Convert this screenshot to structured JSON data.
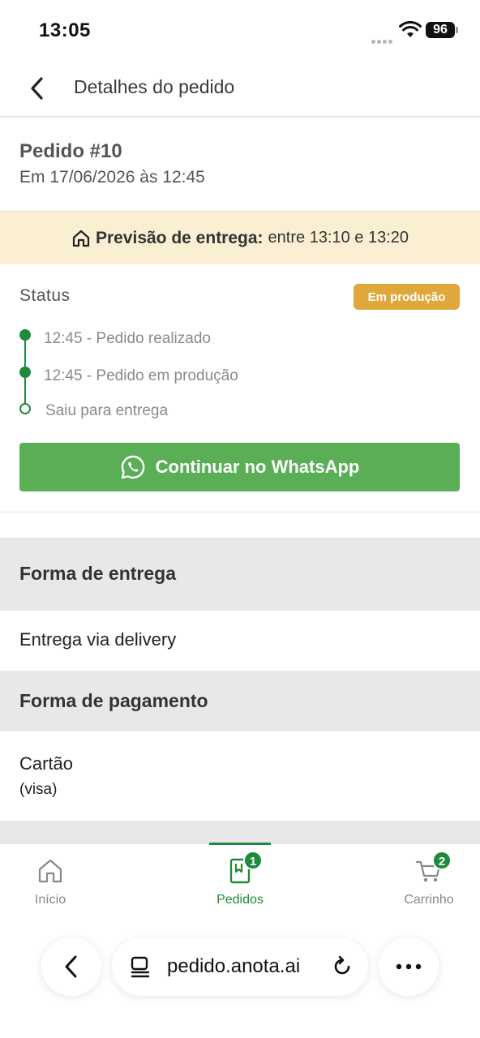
{
  "status_bar": {
    "time": "13:05",
    "battery": "96"
  },
  "header": {
    "title": "Detalhes do pedido"
  },
  "order": {
    "title": "Pedido #10",
    "date": "Em 17/06/2026 às 12:45"
  },
  "delivery_estimate": {
    "label": "Previsão de entrega:",
    "value": "entre 13:10 e 13:20"
  },
  "status": {
    "label": "Status",
    "badge": "Em produção",
    "badge_color": "#e0a83a",
    "timeline": [
      {
        "text": "12:45 - Pedido realizado",
        "done": true
      },
      {
        "text": "12:45 - Pedido em produção",
        "done": true
      },
      {
        "text": "Saiu para entrega",
        "done": false
      }
    ]
  },
  "whatsapp_button": {
    "label": "Continuar no WhatsApp",
    "color": "#5aaf56"
  },
  "delivery_method": {
    "header": "Forma de entrega",
    "value": "Entrega via delivery"
  },
  "payment_method": {
    "header": "Forma de pagamento",
    "value": "Cartão",
    "detail": "(visa)"
  },
  "bottom_nav": {
    "items": [
      {
        "label": "Início",
        "icon": "home-icon",
        "active": false
      },
      {
        "label": "Pedidos",
        "icon": "orders-icon",
        "active": true,
        "badge": "1"
      },
      {
        "label": "Carrinho",
        "icon": "cart-icon",
        "active": false,
        "badge": "2"
      }
    ],
    "accent": "#1e8a3c"
  },
  "browser": {
    "url": "pedido.anota.ai"
  }
}
